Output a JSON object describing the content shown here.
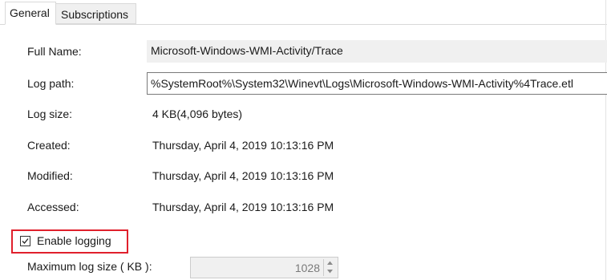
{
  "tabs": [
    {
      "label": "General",
      "selected": true
    },
    {
      "label": "Subscriptions",
      "selected": false
    }
  ],
  "fields": {
    "full_name": {
      "label": "Full Name:",
      "value": "Microsoft-Windows-WMI-Activity/Trace"
    },
    "log_path": {
      "label": "Log path:",
      "value": "%SystemRoot%\\System32\\Winevt\\Logs\\Microsoft-Windows-WMI-Activity%4Trace.etl"
    },
    "log_size": {
      "label": "Log size:",
      "value": "4 KB(4,096 bytes)"
    },
    "created": {
      "label": "Created:",
      "value": "Thursday, April 4, 2019 10:13:16 PM"
    },
    "modified": {
      "label": "Modified:",
      "value": "Thursday, April 4, 2019 10:13:16 PM"
    },
    "accessed": {
      "label": "Accessed:",
      "value": "Thursday, April 4, 2019 10:13:16 PM"
    }
  },
  "enable_logging": {
    "label": "Enable logging",
    "checked": true
  },
  "max_log_size": {
    "label": "Maximum log size ( KB ):",
    "value": "1028"
  },
  "colors": {
    "highlight_border": "#e0202c",
    "readonly_bg": "#f0f0f0"
  },
  "icons": {
    "checkbox": "check-icon",
    "spin_up": "arrow-up-icon",
    "spin_down": "arrow-down-icon"
  }
}
